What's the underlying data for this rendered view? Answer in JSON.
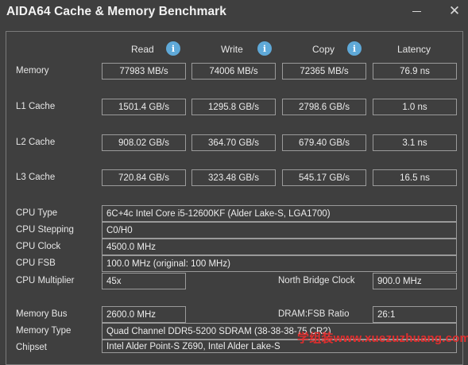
{
  "window": {
    "title": "AIDA64 Cache & Memory Benchmark",
    "minimize_icon": "minimize-icon",
    "close_icon": "close-icon",
    "close_glyph": "✕"
  },
  "columns": {
    "read": "Read",
    "write": "Write",
    "copy": "Copy",
    "latency": "Latency",
    "info_glyph": "i"
  },
  "benchmarks": [
    {
      "label": "Memory",
      "read": "77983 MB/s",
      "write": "74006 MB/s",
      "copy": "72365 MB/s",
      "latency": "76.9 ns"
    },
    {
      "label": "L1 Cache",
      "read": "1501.4 GB/s",
      "write": "1295.8 GB/s",
      "copy": "2798.6 GB/s",
      "latency": "1.0 ns"
    },
    {
      "label": "L2 Cache",
      "read": "908.02 GB/s",
      "write": "364.70 GB/s",
      "copy": "679.40 GB/s",
      "latency": "3.1 ns"
    },
    {
      "label": "L3 Cache",
      "read": "720.84 GB/s",
      "write": "323.48 GB/s",
      "copy": "545.17 GB/s",
      "latency": "16.5 ns"
    }
  ],
  "cpu": {
    "type_label": "CPU Type",
    "type_value": "6C+4c Intel Core i5-12600KF  (Alder Lake-S, LGA1700)",
    "stepping_label": "CPU Stepping",
    "stepping_value": "C0/H0",
    "clock_label": "CPU Clock",
    "clock_value": "4500.0 MHz",
    "fsb_label": "CPU FSB",
    "fsb_value": "100.0 MHz  (original: 100 MHz)",
    "multiplier_label": "CPU Multiplier",
    "multiplier_value": "45x",
    "nb_clock_label": "North Bridge Clock",
    "nb_clock_value": "900.0 MHz"
  },
  "memory": {
    "bus_label": "Memory Bus",
    "bus_value": "2600.0 MHz",
    "ratio_label": "DRAM:FSB Ratio",
    "ratio_value": "26:1",
    "type_label": "Memory Type",
    "type_value": "Quad Channel DDR5-5200 SDRAM  (38-38-38-75 CR2)",
    "chipset_label": "Chipset",
    "chipset_value": "Intel Alder Point-S Z690, Intel Alder Lake-S"
  },
  "watermark": "学组装www.xuezuzhuang.com"
}
